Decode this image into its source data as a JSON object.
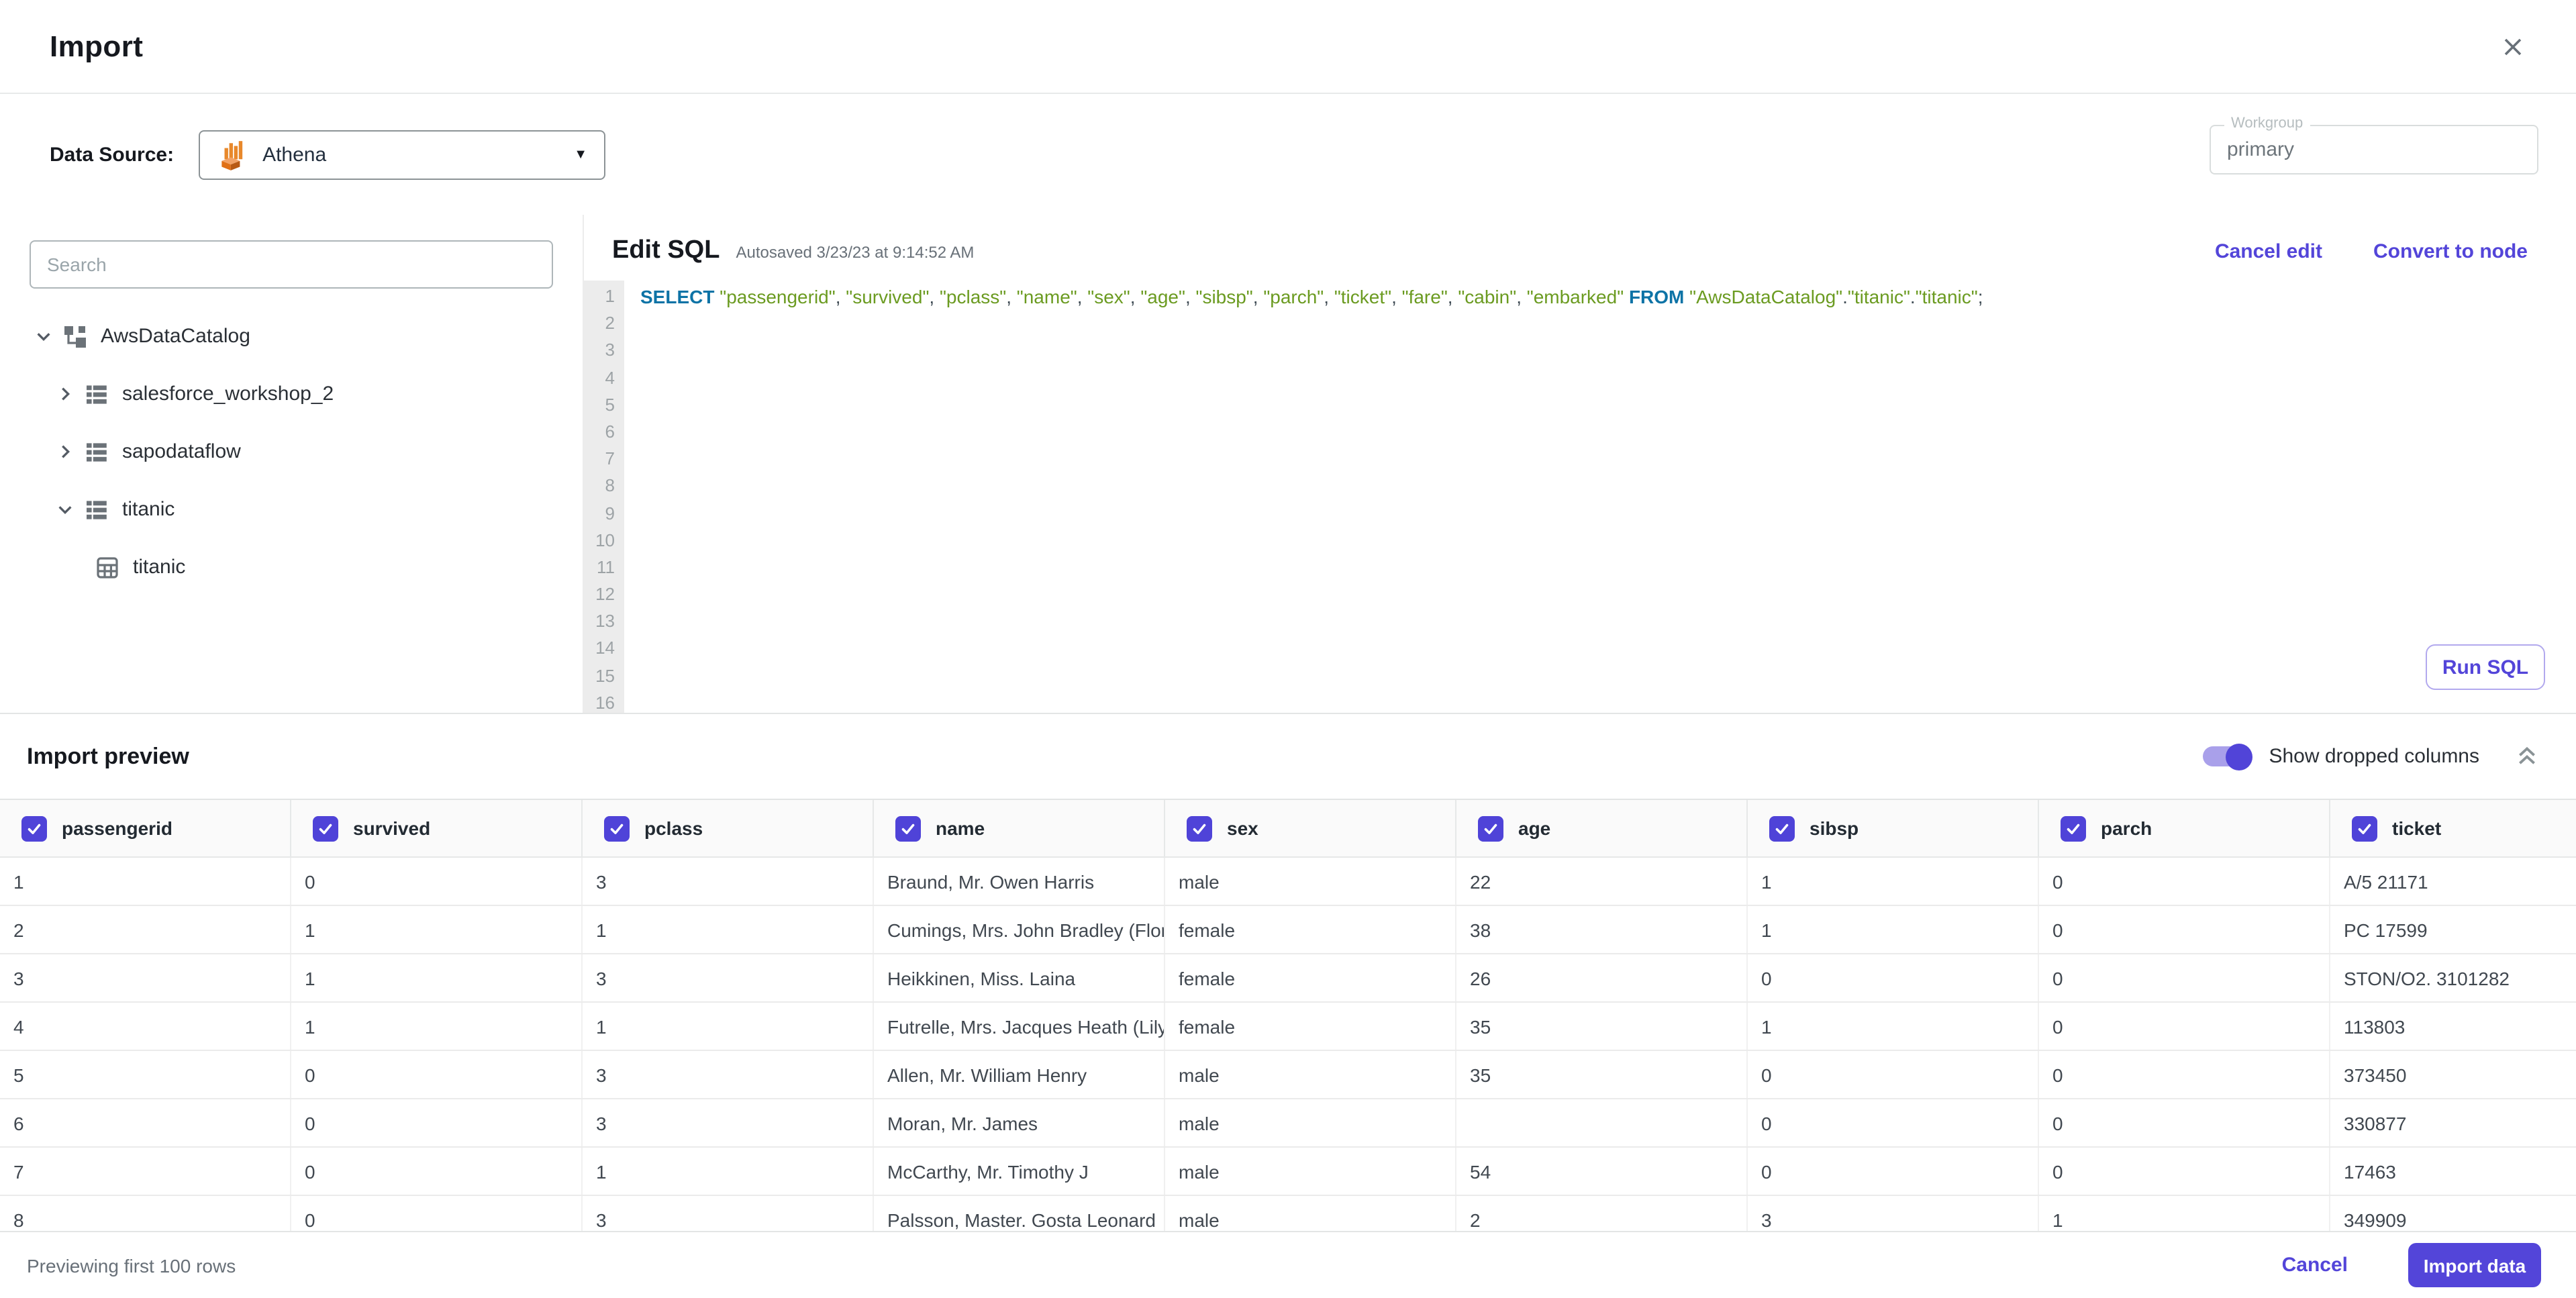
{
  "header": {
    "title": "Import"
  },
  "datasource": {
    "label": "Data Source:",
    "selected": "Athena",
    "workgroup_label": "Workgroup",
    "workgroup_value": "primary"
  },
  "sidebar": {
    "search_placeholder": "Search",
    "tree": [
      {
        "label": "AwsDataCatalog",
        "icon": "catalog-icon",
        "chevron": "down",
        "level": 0
      },
      {
        "label": "salesforce_workshop_2",
        "icon": "database-icon",
        "chevron": "right",
        "level": 1
      },
      {
        "label": "sapodataflow",
        "icon": "database-icon",
        "chevron": "right",
        "level": 1
      },
      {
        "label": "titanic",
        "icon": "database-icon",
        "chevron": "down",
        "level": 1
      },
      {
        "label": "titanic",
        "icon": "table-icon",
        "chevron": "none",
        "level": 2
      }
    ]
  },
  "editor": {
    "title": "Edit SQL",
    "autosaved": "Autosaved 3/23/23 at 9:14:52 AM",
    "cancel_edit_label": "Cancel edit",
    "convert_label": "Convert to node",
    "run_sql_label": "Run SQL",
    "line_count": 16,
    "sql_tokens": [
      {
        "text": "SELECT",
        "type": "keyword"
      },
      {
        "text": " ",
        "type": "plain"
      },
      {
        "text": "\"passengerid\"",
        "type": "string"
      },
      {
        "text": ", ",
        "type": "plain"
      },
      {
        "text": "\"survived\"",
        "type": "string"
      },
      {
        "text": ", ",
        "type": "plain"
      },
      {
        "text": "\"pclass\"",
        "type": "string"
      },
      {
        "text": ", ",
        "type": "plain"
      },
      {
        "text": "\"name\"",
        "type": "string"
      },
      {
        "text": ", ",
        "type": "plain"
      },
      {
        "text": "\"sex\"",
        "type": "string"
      },
      {
        "text": ", ",
        "type": "plain"
      },
      {
        "text": "\"age\"",
        "type": "string"
      },
      {
        "text": ", ",
        "type": "plain"
      },
      {
        "text": "\"sibsp\"",
        "type": "string"
      },
      {
        "text": ", ",
        "type": "plain"
      },
      {
        "text": "\"parch\"",
        "type": "string"
      },
      {
        "text": ", ",
        "type": "plain"
      },
      {
        "text": "\"ticket\"",
        "type": "string"
      },
      {
        "text": ", ",
        "type": "plain"
      },
      {
        "text": "\"fare\"",
        "type": "string"
      },
      {
        "text": ", ",
        "type": "plain"
      },
      {
        "text": "\"cabin\"",
        "type": "string"
      },
      {
        "text": ", ",
        "type": "plain"
      },
      {
        "text": "\"embarked\"",
        "type": "string"
      },
      {
        "text": " ",
        "type": "plain"
      },
      {
        "text": "FROM",
        "type": "keyword"
      },
      {
        "text": " ",
        "type": "plain"
      },
      {
        "text": "\"AwsDataCatalog\"",
        "type": "string"
      },
      {
        "text": ".",
        "type": "plain"
      },
      {
        "text": "\"titanic\"",
        "type": "string"
      },
      {
        "text": ".",
        "type": "plain"
      },
      {
        "text": "\"titanic\"",
        "type": "string"
      },
      {
        "text": ";",
        "type": "plain"
      }
    ]
  },
  "preview": {
    "title": "Import preview",
    "toggle_label": "Show dropped columns",
    "toggle_on": true,
    "columns": [
      {
        "label": "passengerid",
        "checked": true
      },
      {
        "label": "survived",
        "checked": true
      },
      {
        "label": "pclass",
        "checked": true
      },
      {
        "label": "name",
        "checked": true
      },
      {
        "label": "sex",
        "checked": true
      },
      {
        "label": "age",
        "checked": true
      },
      {
        "label": "sibsp",
        "checked": true
      },
      {
        "label": "parch",
        "checked": true
      },
      {
        "label": "ticket",
        "checked": true
      }
    ],
    "rows": [
      [
        "1",
        "0",
        "3",
        "Braund, Mr. Owen Harris",
        "male",
        "22",
        "1",
        "0",
        "A/5 21171"
      ],
      [
        "2",
        "1",
        "1",
        "Cumings, Mrs. John Bradley (Florenc",
        "female",
        "38",
        "1",
        "0",
        "PC 17599"
      ],
      [
        "3",
        "1",
        "3",
        "Heikkinen, Miss. Laina",
        "female",
        "26",
        "0",
        "0",
        "STON/O2. 3101282"
      ],
      [
        "4",
        "1",
        "1",
        "Futrelle, Mrs. Jacques Heath (Lily Ma",
        "female",
        "35",
        "1",
        "0",
        "113803"
      ],
      [
        "5",
        "0",
        "3",
        "Allen, Mr. William Henry",
        "male",
        "35",
        "0",
        "0",
        "373450"
      ],
      [
        "6",
        "0",
        "3",
        "Moran, Mr. James",
        "male",
        "",
        "0",
        "0",
        "330877"
      ],
      [
        "7",
        "0",
        "1",
        "McCarthy, Mr. Timothy J",
        "male",
        "54",
        "0",
        "0",
        "17463"
      ],
      [
        "8",
        "0",
        "3",
        "Palsson, Master. Gosta Leonard",
        "male",
        "2",
        "3",
        "1",
        "349909"
      ]
    ],
    "footer_note": "Previewing first 100 rows",
    "cancel_label": "Cancel",
    "import_label": "Import data"
  },
  "colors": {
    "accent_purple": "#5345d9",
    "toggle_track": "#a9a0ea",
    "sql_keyword": "#0d73a6",
    "sql_string": "#6b9b21",
    "athena_orange": "#e8772b"
  }
}
